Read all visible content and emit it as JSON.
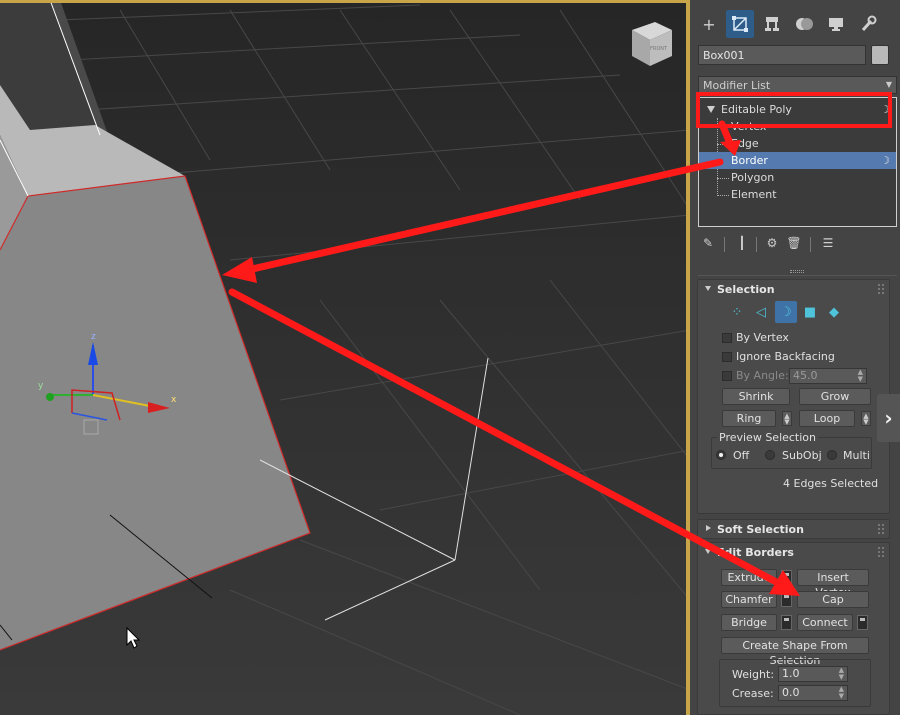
{
  "viewport": {
    "gizmo": {
      "x_label": "x",
      "y_label": "y",
      "z_label": "z"
    },
    "viewcube_label": "FRONT"
  },
  "panel": {
    "tabs": [
      {
        "name": "create",
        "icon": "plus-icon"
      },
      {
        "name": "modify",
        "icon": "modify-icon"
      },
      {
        "name": "hierarchy",
        "icon": "hierarchy-icon"
      },
      {
        "name": "motion",
        "icon": "motion-icon"
      },
      {
        "name": "display",
        "icon": "display-icon"
      },
      {
        "name": "utilities",
        "icon": "wrench-icon"
      }
    ],
    "object_name": "Box001",
    "object_color": "#b9b9b9",
    "modifier_list": "Modifier List",
    "stack": {
      "head": "Editable Poly",
      "items": [
        "Vertex",
        "Edge",
        "Border",
        "Polygon",
        "Element"
      ],
      "selected": "Border"
    },
    "rollouts": {
      "selection": {
        "title": "Selection",
        "by_vertex": "By Vertex",
        "ignore_backfacing": "Ignore Backfacing",
        "by_angle": "By Angle:",
        "by_angle_value": "45.0",
        "shrink": "Shrink",
        "grow": "Grow",
        "ring": "Ring",
        "loop": "Loop",
        "preview_title": "Preview Selection",
        "preview_off": "Off",
        "preview_subobj": "SubObj",
        "preview_multi": "Multi",
        "status": "4 Edges Selected"
      },
      "soft_selection": {
        "title": "Soft Selection"
      },
      "edit_borders": {
        "title": "Edit Borders",
        "extrude": "Extrude",
        "insert_vertex": "Insert Vertex",
        "chamfer": "Chamfer",
        "cap": "Cap",
        "bridge": "Bridge",
        "connect": "Connect",
        "create_shape": "Create Shape From Selection",
        "weight_label": "Weight:",
        "weight_value": "1.0",
        "crease_label": "Crease:",
        "crease_value": "0.0"
      }
    }
  },
  "colors": {
    "accent": "#557ab0",
    "annotation": "#ff1a1a",
    "viewport_frame": "#c9a54a"
  }
}
